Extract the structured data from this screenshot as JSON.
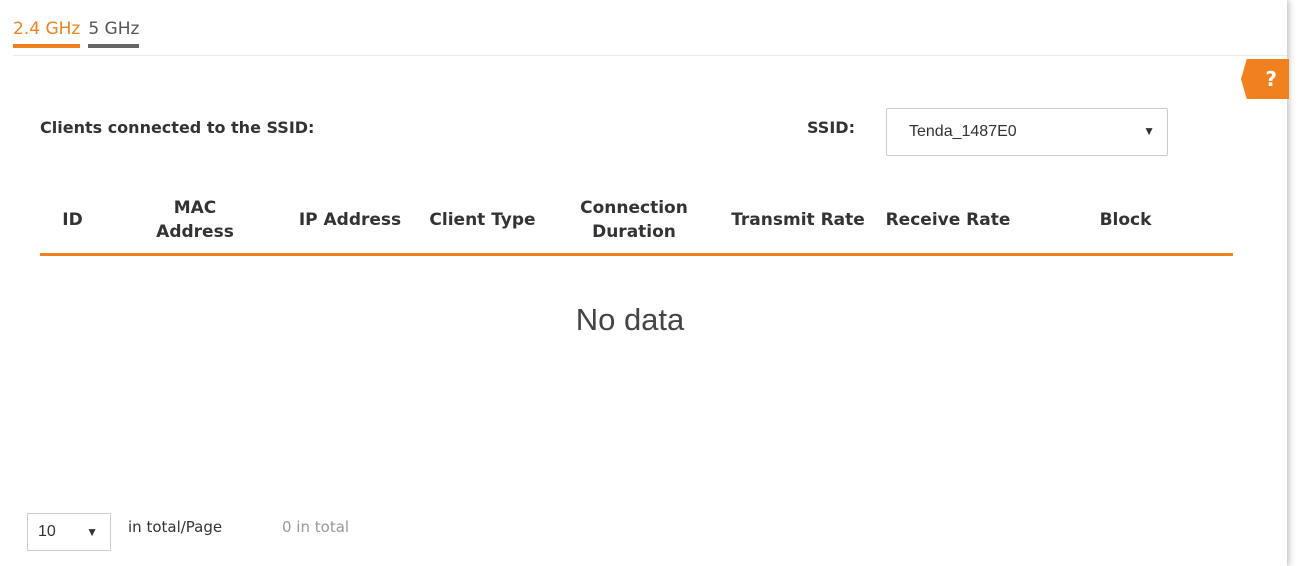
{
  "tabs": [
    {
      "label": "2.4 GHz",
      "active": true
    },
    {
      "label": "5 GHz",
      "active": false
    }
  ],
  "help": {
    "label": "?",
    "icon": "help-icon"
  },
  "clients_label": "Clients connected to the SSID:",
  "ssid": {
    "label": "SSID:",
    "value": "Tenda_1487E0",
    "arrow": "▼"
  },
  "table": {
    "headers": {
      "id": "ID",
      "mac_line1": "MAC",
      "mac_line2": "Address",
      "ip": "IP Address",
      "client_type": "Client Type",
      "duration_line1": "Connection",
      "duration_line2": "Duration",
      "transmit": "Transmit Rate",
      "receive": "Receive Rate",
      "block": "Block"
    },
    "empty_text": "No data"
  },
  "pagination": {
    "page_size": "10",
    "arrow": "▼",
    "per_page_label": "in total/Page",
    "total_label": "0 in total"
  },
  "colors": {
    "accent": "#f0811e",
    "muted": "#999999"
  }
}
